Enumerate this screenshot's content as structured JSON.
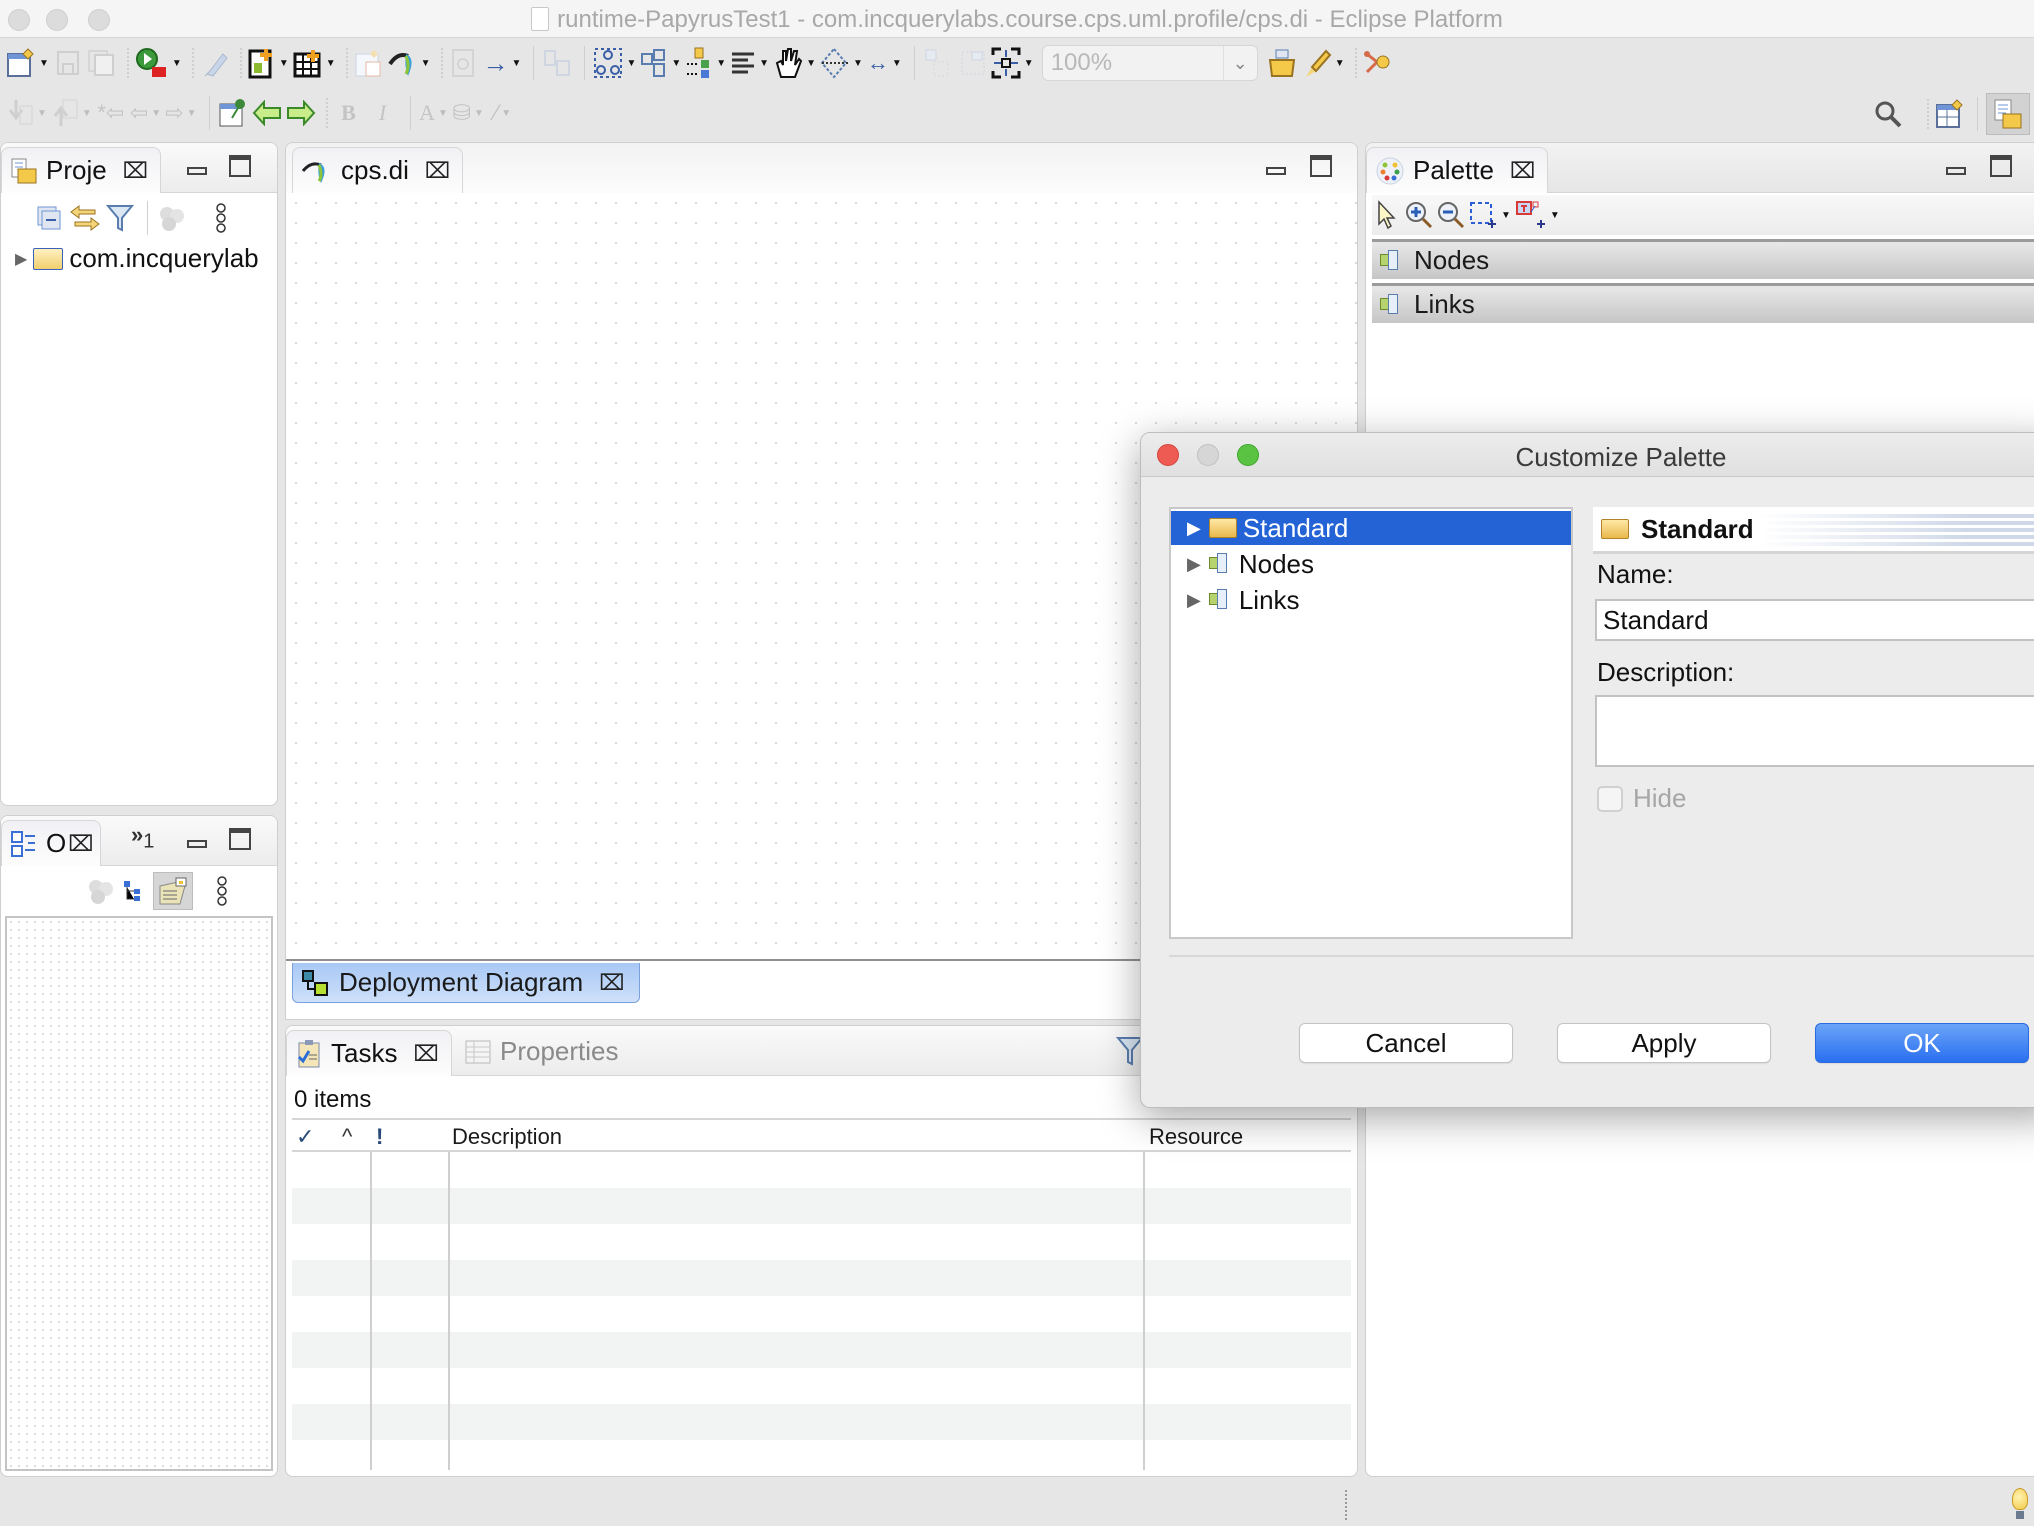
{
  "window": {
    "title": "runtime-PapyrusTest1 - com.incquerylabs.course.cps.uml.profile/cps.di - Eclipse Platform"
  },
  "toolbar": {
    "zoom_value": "100%"
  },
  "project_explorer": {
    "tab_label": "Proje",
    "tree": [
      {
        "label": "com.incquerylab",
        "expanded": false
      }
    ]
  },
  "outline": {
    "tab_label": "O",
    "overflow_label": "»",
    "overflow_count": "1"
  },
  "editor": {
    "tab_label": "cps.di",
    "diagram_tab_label": "Deployment Diagram"
  },
  "tasks": {
    "tab_label": "Tasks",
    "properties_tab_label": "Properties",
    "item_count": "0 items",
    "columns": [
      "✓",
      "^",
      "!",
      "Description",
      "Resource"
    ],
    "rows": []
  },
  "palette": {
    "tab_label": "Palette",
    "drawers": [
      {
        "label": "Nodes"
      },
      {
        "label": "Links"
      }
    ]
  },
  "dialog": {
    "title": "Customize Palette",
    "tree": [
      {
        "label": "Standard",
        "selected": true
      },
      {
        "label": "Nodes",
        "selected": false
      },
      {
        "label": "Links",
        "selected": false
      }
    ],
    "banner_title": "Standard",
    "name_label": "Name:",
    "name_value": "Standard",
    "description_label": "Description:",
    "description_value": "",
    "hide_label": "Hide",
    "hide_checked": false,
    "hide_enabled": false,
    "buttons": {
      "cancel": "Cancel",
      "apply": "Apply",
      "ok": "OK"
    },
    "colors": {
      "selection": "#2463d6",
      "ok_button": "#2a6ff0",
      "close_light": "#ee5b52",
      "zoom_light": "#5bc342"
    }
  }
}
